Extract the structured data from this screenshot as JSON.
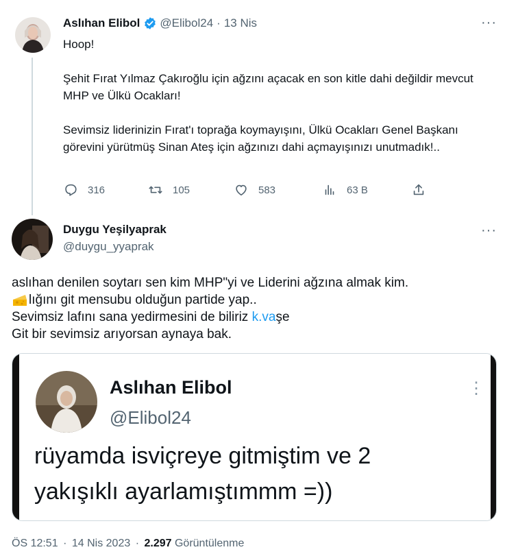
{
  "quoted_tweet": {
    "author_name": "Aslıhan Elibol",
    "handle": "@Elibol24",
    "separator": "·",
    "date": "13 Nis",
    "more": "···",
    "paragraphs": [
      "Hoop!",
      "Şehit Fırat Yılmaz Çakıroğlu için ağzını açacak en son kitle dahi değildir mevcut MHP ve Ülkü Ocakları!",
      "Sevimsiz liderinizin Fırat'ı toprağa koymayışını, Ülkü Ocakları Genel Başkanı görevini yürütmüş Sinan Ateş için ağzınızı dahi açmayışınızı unutmadık!.."
    ],
    "actions": {
      "replies": "316",
      "retweets": "105",
      "likes": "583",
      "views": "63 B"
    }
  },
  "reply_tweet": {
    "author_name": "Duygu Yeşilyaprak",
    "handle": "@duygu_yyaprak",
    "more": "···",
    "lines": {
      "line1": "aslıhan denilen soytarı sen kim MHP\"yi ve Liderini ağzına almak kim.",
      "line2_rest": "lığını git mensubu olduğun partide yap..",
      "line3_pre": "Sevimsiz lafını sana yedirmesini de biliriz ",
      "line3_link": "k.va",
      "line3_post": "şe",
      "line4": "Git bir sevimsiz arıyorsan aynaya bak."
    },
    "emoji": "cheese-emoji",
    "footer": {
      "time": "ÖS 12:51",
      "dot1": "·",
      "date": "14 Nis 2023",
      "dot2": "·",
      "views_count": "2.297",
      "views_label": "Görüntülenme"
    }
  },
  "screenshot_card": {
    "name": "Aslıhan Elibol",
    "handle": "@Elibol24",
    "text_line1": "rüyamda isviçreye gitmiştim ve 2",
    "text_line2": "yakışıklı ayarlamıştımmm =))",
    "more": "⋮"
  },
  "colors": {
    "verified": "#1d9bf0",
    "link": "#1d9bf0",
    "muted": "#536471",
    "thread_line": "#cfd9de"
  }
}
